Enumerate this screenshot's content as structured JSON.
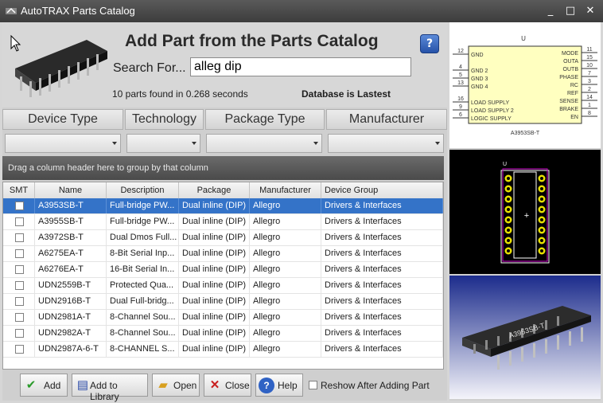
{
  "window": {
    "title": "AutoTRAX Parts Catalog"
  },
  "header": {
    "title": "Add Part from the Parts Catalog",
    "search_label": "Search For...",
    "search_value": "alleg dip",
    "found_text": "10 parts found in 0.268 seconds",
    "db_status": "Database is Lastest",
    "help_glyph": "?"
  },
  "filters": [
    {
      "label": "Device Type",
      "value": ""
    },
    {
      "label": "Technology",
      "value": ""
    },
    {
      "label": "Package Type",
      "value": ""
    },
    {
      "label": "Manufacturer",
      "value": ""
    }
  ],
  "group_hint": "Drag a column header here to group by that column",
  "grid": {
    "columns": [
      "SMT",
      "Name",
      "Description",
      "Package",
      "Manufacturer",
      "Device Group"
    ],
    "selected_index": 0,
    "rows": [
      {
        "smt": false,
        "name": "A3953SB-T",
        "description": "Full-bridge PW...",
        "package": "Dual inline (DIP)",
        "manufacturer": "Allegro",
        "group": "Drivers & Interfaces"
      },
      {
        "smt": false,
        "name": "A3955SB-T",
        "description": "Full-bridge PW...",
        "package": "Dual inline (DIP)",
        "manufacturer": "Allegro",
        "group": "Drivers & Interfaces"
      },
      {
        "smt": false,
        "name": "A3972SB-T",
        "description": "Dual Dmos Full...",
        "package": "Dual inline (DIP)",
        "manufacturer": "Allegro",
        "group": "Drivers & Interfaces"
      },
      {
        "smt": false,
        "name": "A6275EA-T",
        "description": "8-Bit Serial Inp...",
        "package": "Dual inline (DIP)",
        "manufacturer": "Allegro",
        "group": "Drivers & Interfaces"
      },
      {
        "smt": false,
        "name": "A6276EA-T",
        "description": "16-Bit Serial In...",
        "package": "Dual inline (DIP)",
        "manufacturer": "Allegro",
        "group": "Drivers & Interfaces"
      },
      {
        "smt": false,
        "name": "UDN2559B-T",
        "description": "Protected Qua...",
        "package": "Dual inline (DIP)",
        "manufacturer": "Allegro",
        "group": "Drivers & Interfaces"
      },
      {
        "smt": false,
        "name": "UDN2916B-T",
        "description": "Dual Full-bridg...",
        "package": "Dual inline (DIP)",
        "manufacturer": "Allegro",
        "group": "Drivers & Interfaces"
      },
      {
        "smt": false,
        "name": "UDN2981A-T",
        "description": "8-Channel Sou...",
        "package": "Dual inline (DIP)",
        "manufacturer": "Allegro",
        "group": "Drivers & Interfaces"
      },
      {
        "smt": false,
        "name": "UDN2982A-T",
        "description": "8-Channel Sou...",
        "package": "Dual inline (DIP)",
        "manufacturer": "Allegro",
        "group": "Drivers & Interfaces"
      },
      {
        "smt": false,
        "name": "UDN2987A-6-T",
        "description": "8-CHANNEL S...",
        "package": "Dual inline (DIP)",
        "manufacturer": "Allegro",
        "group": "Drivers & Interfaces"
      }
    ]
  },
  "buttons": {
    "add": "Add",
    "add_to_library": "Add to Library",
    "open": "Open",
    "close": "Close",
    "help": "Help",
    "reshow": "Reshow After Adding Part"
  },
  "schematic": {
    "ref": "U",
    "part": "A3953SB-T",
    "left_pins": [
      {
        "num": "12",
        "name": "GND"
      },
      {
        "num": "4",
        "name": "GND 2"
      },
      {
        "num": "5",
        "name": "GND 3"
      },
      {
        "num": "13",
        "name": "GND 4"
      },
      {
        "num": "16",
        "name": "LOAD SUPPLY"
      },
      {
        "num": "9",
        "name": "LOAD SUPPLY 2"
      },
      {
        "num": "6",
        "name": "LOGIC SUPPLY"
      }
    ],
    "right_pins": [
      {
        "num": "11",
        "name": "MODE"
      },
      {
        "num": "15",
        "name": "OUTA"
      },
      {
        "num": "10",
        "name": "OUTB"
      },
      {
        "num": "7",
        "name": "PHASE"
      },
      {
        "num": "3",
        "name": "RC"
      },
      {
        "num": "2",
        "name": "REF"
      },
      {
        "num": "14",
        "name": "SENSE"
      },
      {
        "num": "1",
        "name": "BRAKE"
      },
      {
        "num": "8",
        "name": "EN"
      }
    ]
  },
  "footprint": {
    "ref": "U"
  },
  "render3d": {
    "marking": "A3953SB-T"
  },
  "colors": {
    "selection": "#3473c8",
    "schematic_fill": "#ffffc0",
    "footprint_pad": "#e8e000",
    "outline": "#cc00cc"
  },
  "icons": [
    "app-icon",
    "ic-chip-icon",
    "help-icon",
    "check-icon",
    "library-icon",
    "folder-icon",
    "close-icon"
  ]
}
